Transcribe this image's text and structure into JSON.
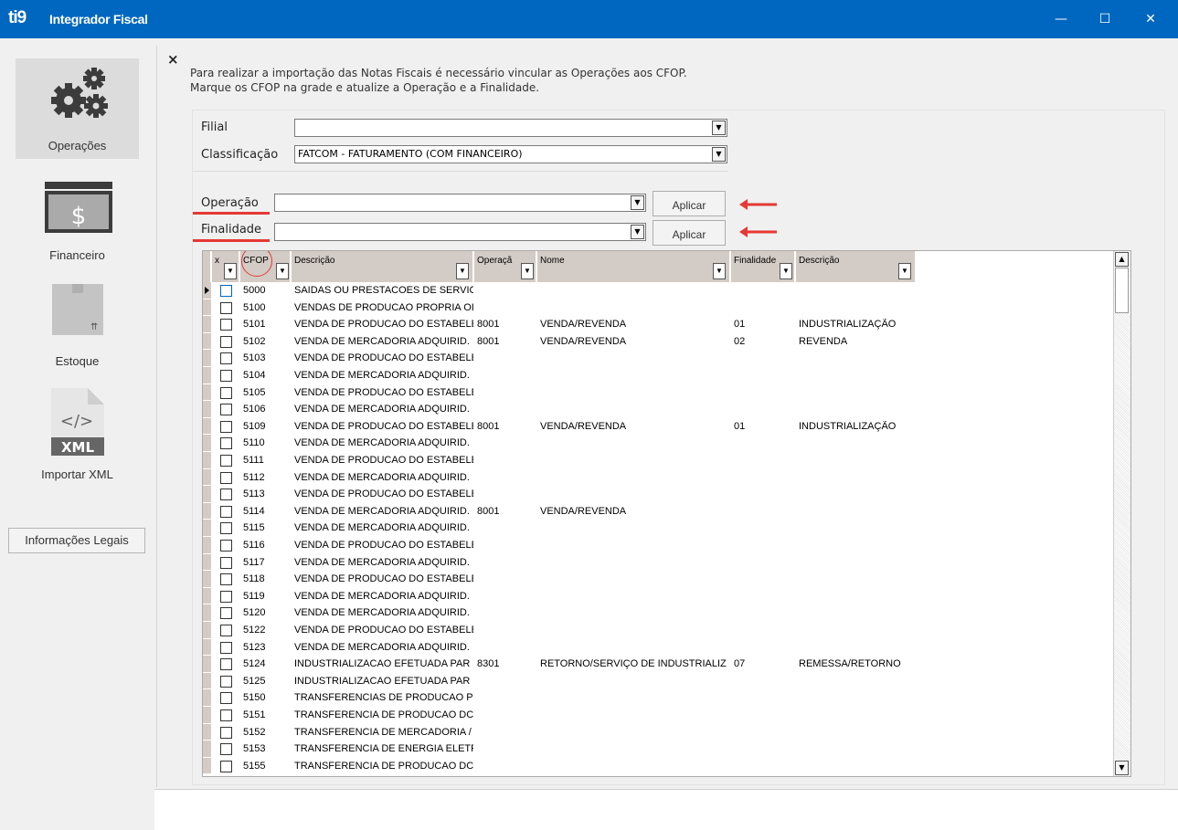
{
  "app": {
    "logo": "ti9",
    "title": "Integrador Fiscal",
    "colors": {
      "titlebar": "#0067c0",
      "highlight": "#e53935"
    }
  },
  "window_controls": {
    "minimize": "—",
    "maximize": "☐",
    "close": "✕"
  },
  "sidebar": {
    "items": [
      {
        "label": "Operações",
        "icon": "gears-icon",
        "active": true
      },
      {
        "label": "Financeiro",
        "icon": "money-icon",
        "active": false
      },
      {
        "label": "Estoque",
        "icon": "box-icon",
        "active": false
      },
      {
        "label": "Importar XML",
        "icon": "xml-file-icon",
        "active": false
      }
    ],
    "legal_button": "Informações Legais"
  },
  "main": {
    "close": "×",
    "info_line1": "Para realizar a importação das Notas Fiscais é necessário vincular as Operações aos CFOP.",
    "info_line2": "Marque os CFOP na grade e atualize a Operação e a Finalidade.",
    "filial_label": "Filial",
    "filial_value": "",
    "classificacao_label": "Classificação",
    "classificacao_value": "FATCOM - FATURAMENTO (COM FINANCEIRO)",
    "operacao_label": "Operação",
    "operacao_value": "",
    "finalidade_label": "Finalidade",
    "finalidade_value": "",
    "apply_label": "Aplicar",
    "dropdown_arrow": "▼"
  },
  "grid": {
    "headers": {
      "check": "x",
      "cfop": "CFOP",
      "descricao": "Descrição",
      "operacao": "Operaçã",
      "nome": "Nome",
      "finalidade": "Finalidade",
      "descricao2": "Descrição"
    },
    "rows": [
      {
        "cfop": "5000",
        "descricao": "SAIDAS OU PRESTACOES DE SERVIC",
        "operacao": "",
        "nome": "",
        "finalidade": "",
        "descricao2": ""
      },
      {
        "cfop": "5100",
        "descricao": "VENDAS DE PRODUCAO PROPRIA OI",
        "operacao": "",
        "nome": "",
        "finalidade": "",
        "descricao2": ""
      },
      {
        "cfop": "5101",
        "descricao": "VENDA DE PRODUCAO DO ESTABELE",
        "operacao": "8001",
        "nome": "VENDA/REVENDA",
        "finalidade": "01",
        "descricao2": "INDUSTRIALIZAÇÃO"
      },
      {
        "cfop": "5102",
        "descricao": "VENDA DE MERCADORIA ADQUIRID.",
        "operacao": "8001",
        "nome": "VENDA/REVENDA",
        "finalidade": "02",
        "descricao2": "REVENDA"
      },
      {
        "cfop": "5103",
        "descricao": "VENDA DE PRODUCAO DO ESTABELE",
        "operacao": "",
        "nome": "",
        "finalidade": "",
        "descricao2": ""
      },
      {
        "cfop": "5104",
        "descricao": "VENDA DE MERCADORIA ADQUIRID.",
        "operacao": "",
        "nome": "",
        "finalidade": "",
        "descricao2": ""
      },
      {
        "cfop": "5105",
        "descricao": "VENDA DE PRODUCAO DO ESTABELE",
        "operacao": "",
        "nome": "",
        "finalidade": "",
        "descricao2": ""
      },
      {
        "cfop": "5106",
        "descricao": "VENDA DE MERCADORIA ADQUIRID.",
        "operacao": "",
        "nome": "",
        "finalidade": "",
        "descricao2": ""
      },
      {
        "cfop": "5109",
        "descricao": "VENDA DE PRODUCAO DO ESTABELE",
        "operacao": "8001",
        "nome": "VENDA/REVENDA",
        "finalidade": "01",
        "descricao2": "INDUSTRIALIZAÇÃO"
      },
      {
        "cfop": "5110",
        "descricao": "VENDA DE MERCADORIA ADQUIRID.",
        "operacao": "",
        "nome": "",
        "finalidade": "",
        "descricao2": ""
      },
      {
        "cfop": "5111",
        "descricao": "VENDA DE PRODUCAO DO ESTABELE",
        "operacao": "",
        "nome": "",
        "finalidade": "",
        "descricao2": ""
      },
      {
        "cfop": "5112",
        "descricao": "VENDA DE MERCADORIA ADQUIRID.",
        "operacao": "",
        "nome": "",
        "finalidade": "",
        "descricao2": ""
      },
      {
        "cfop": "5113",
        "descricao": "VENDA DE PRODUCAO DO ESTABELE",
        "operacao": "",
        "nome": "",
        "finalidade": "",
        "descricao2": ""
      },
      {
        "cfop": "5114",
        "descricao": "VENDA DE MERCADORIA ADQUIRID.",
        "operacao": "8001",
        "nome": "VENDA/REVENDA",
        "finalidade": "",
        "descricao2": ""
      },
      {
        "cfop": "5115",
        "descricao": "VENDA DE MERCADORIA ADQUIRID.",
        "operacao": "",
        "nome": "",
        "finalidade": "",
        "descricao2": ""
      },
      {
        "cfop": "5116",
        "descricao": "VENDA DE PRODUCAO DO ESTABELE",
        "operacao": "",
        "nome": "",
        "finalidade": "",
        "descricao2": ""
      },
      {
        "cfop": "5117",
        "descricao": "VENDA DE MERCADORIA ADQUIRID.",
        "operacao": "",
        "nome": "",
        "finalidade": "",
        "descricao2": ""
      },
      {
        "cfop": "5118",
        "descricao": "VENDA DE PRODUCAO DO ESTABELE",
        "operacao": "",
        "nome": "",
        "finalidade": "",
        "descricao2": ""
      },
      {
        "cfop": "5119",
        "descricao": "VENDA DE MERCADORIA ADQUIRID.",
        "operacao": "",
        "nome": "",
        "finalidade": "",
        "descricao2": ""
      },
      {
        "cfop": "5120",
        "descricao": "VENDA DE MERCADORIA ADQUIRID.",
        "operacao": "",
        "nome": "",
        "finalidade": "",
        "descricao2": ""
      },
      {
        "cfop": "5122",
        "descricao": "VENDA DE PRODUCAO DO ESTABELE",
        "operacao": "",
        "nome": "",
        "finalidade": "",
        "descricao2": ""
      },
      {
        "cfop": "5123",
        "descricao": "VENDA DE MERCADORIA ADQUIRID.",
        "operacao": "",
        "nome": "",
        "finalidade": "",
        "descricao2": ""
      },
      {
        "cfop": "5124",
        "descricao": "INDUSTRIALIZACAO EFETUADA PAR",
        "operacao": "8301",
        "nome": "RETORNO/SERVIÇO DE INDUSTRIALIZ",
        "finalidade": "07",
        "descricao2": "REMESSA/RETORNO"
      },
      {
        "cfop": "5125",
        "descricao": "INDUSTRIALIZACAO EFETUADA PAR",
        "operacao": "",
        "nome": "",
        "finalidade": "",
        "descricao2": ""
      },
      {
        "cfop": "5150",
        "descricao": "TRANSFERENCIAS DE PRODUCAO PI",
        "operacao": "",
        "nome": "",
        "finalidade": "",
        "descricao2": ""
      },
      {
        "cfop": "5151",
        "descricao": "TRANSFERENCIA DE PRODUCAO DC",
        "operacao": "",
        "nome": "",
        "finalidade": "",
        "descricao2": ""
      },
      {
        "cfop": "5152",
        "descricao": "TRANSFERENCIA DE MERCADORIA /",
        "operacao": "",
        "nome": "",
        "finalidade": "",
        "descricao2": ""
      },
      {
        "cfop": "5153",
        "descricao": "TRANSFERENCIA DE ENERGIA ELETF",
        "operacao": "",
        "nome": "",
        "finalidade": "",
        "descricao2": ""
      },
      {
        "cfop": "5155",
        "descricao": "TRANSFERENCIA DE PRODUCAO DC",
        "operacao": "",
        "nome": "",
        "finalidade": "",
        "descricao2": ""
      }
    ]
  }
}
